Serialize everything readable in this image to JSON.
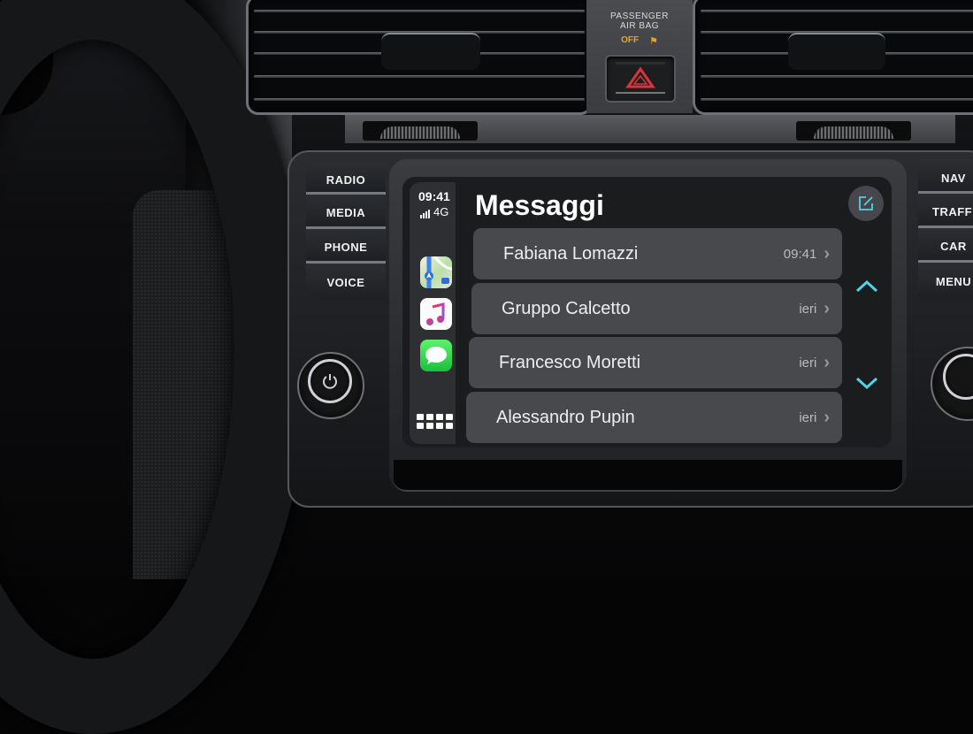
{
  "dashboard": {
    "airbag_label_line1": "PASSENGER",
    "airbag_label_line2": "AIR BAG",
    "airbag_status": "OFF",
    "hazard_button": "hazard-warning",
    "left_buttons": [
      "RADIO",
      "MEDIA",
      "PHONE",
      "VOICE"
    ],
    "right_buttons": [
      "NAV",
      "TRAFFIC",
      "CAR",
      "MENU"
    ],
    "power_knob": "power-icon"
  },
  "carplay": {
    "status": {
      "time": "09:41",
      "network": "4G",
      "signal_bars": 4
    },
    "dock_apps": [
      {
        "name": "Maps",
        "icon": "maps-icon"
      },
      {
        "name": "Music",
        "icon": "music-icon"
      },
      {
        "name": "Messages",
        "icon": "messages-icon"
      }
    ],
    "home_icon": "app-grid-icon",
    "title": "Messaggi",
    "compose_icon": "compose-icon",
    "conversations": [
      {
        "name": "Fabiana Lomazzi",
        "time": "09:41"
      },
      {
        "name": "Gruppo Calcetto",
        "time": "ieri"
      },
      {
        "name": "Francesco Moretti",
        "time": "ieri"
      },
      {
        "name": "Alessandro Pupin",
        "time": "ieri"
      }
    ],
    "accent_color": "#53d1e6"
  }
}
